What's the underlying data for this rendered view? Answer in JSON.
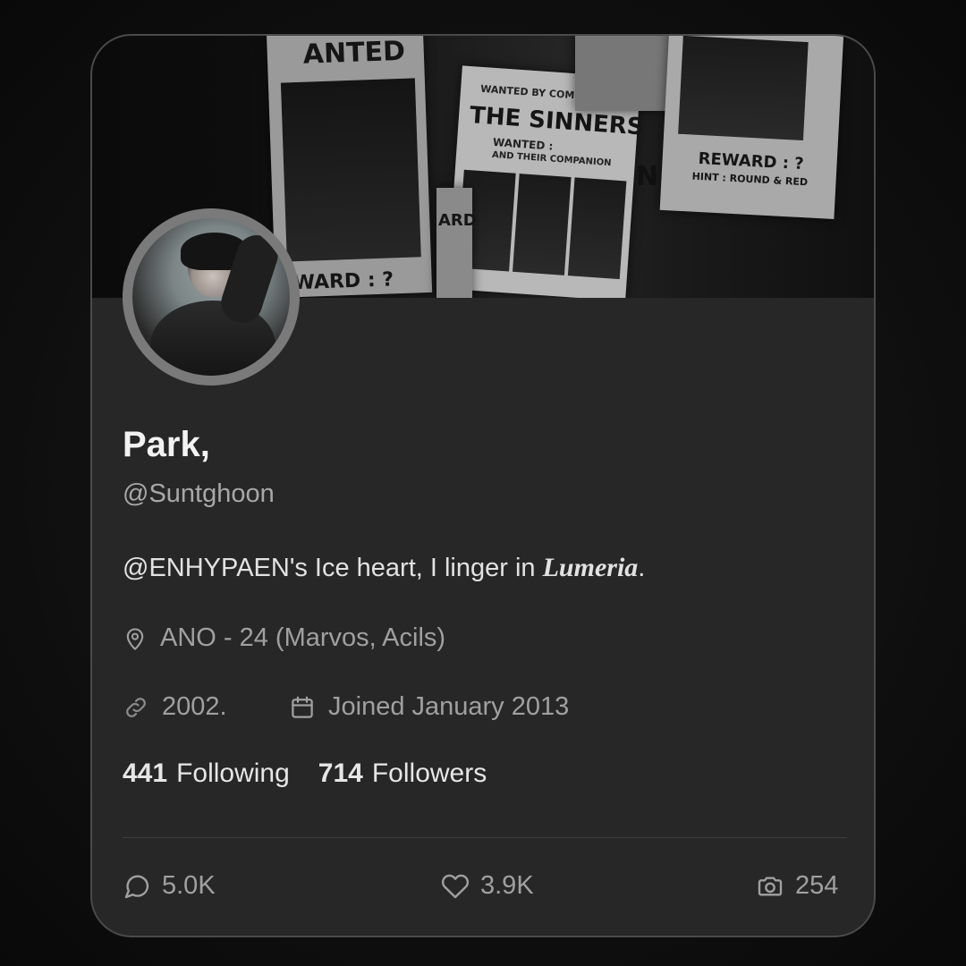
{
  "profile": {
    "name": "Park,",
    "handle": "@Suntghoon",
    "bio_prefix": "@ENHYPAEN's Ice heart, I linger in ",
    "bio_emphasis": "Lumeria",
    "bio_suffix": ".",
    "location": "ANO - 24 (Marvos, Acils)",
    "website": "2002.",
    "joined": "Joined January 2013"
  },
  "stats": {
    "following_count": "441",
    "following_label": "Following",
    "followers_count": "714",
    "followers_label": "Followers"
  },
  "actions": {
    "comments": "5.0K",
    "likes": "3.9K",
    "photos": "254"
  },
  "banner": {
    "poster_wanted": "ANTED",
    "poster_wanted_by": "WANTED BY COMMITTEE",
    "poster_sinners": "THE SINNERS",
    "poster_wanted2": "WANTED :",
    "poster_companion": "AND THEIR COMPANION",
    "poster_reward": "REWARD : ?",
    "poster_hint": "HINT : ROUND & RED",
    "poster_reward_partial": "WARD : ?",
    "poster_ard": "ARD",
    "poster_n": "N"
  },
  "colors": {
    "card_bg": "#272727",
    "card_border": "#4a4a4a",
    "text_primary": "#f2f2f2",
    "text_secondary": "#a0a0a0"
  }
}
